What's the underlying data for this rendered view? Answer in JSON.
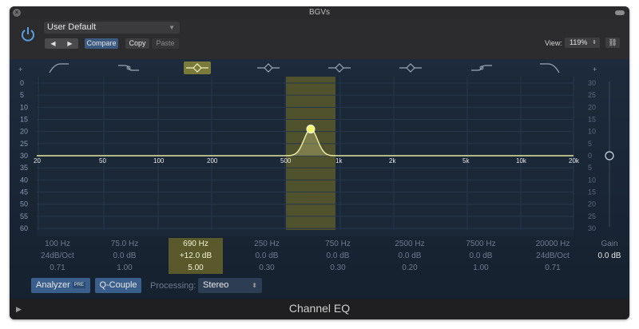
{
  "window": {
    "title": "BGVs",
    "close_glyph": "×"
  },
  "header": {
    "preset": "User Default",
    "compare_label": "Compare",
    "copy_label": "Copy",
    "paste_label": "Paste",
    "view_label": "View:",
    "zoom": "119%",
    "prev_icon": "◀",
    "next_icon": "▶"
  },
  "eq": {
    "left_scale": [
      "0",
      "5",
      "10",
      "15",
      "20",
      "25",
      "30",
      "35",
      "40",
      "45",
      "50",
      "55",
      "60"
    ],
    "right_scale": [
      "30",
      "25",
      "20",
      "15",
      "10",
      "5",
      "0",
      "5",
      "10",
      "15",
      "20",
      "25",
      "30"
    ],
    "freq_labels": [
      "20",
      "50",
      "100",
      "200",
      "500",
      "1k",
      "2k",
      "5k",
      "10k",
      "20k"
    ],
    "active_band_index": 2,
    "curve_color": "#e8e8a0",
    "highlight_color": "#59592c"
  },
  "bands": [
    {
      "freq": "100 Hz",
      "gain": "24dB/Oct",
      "q": "0.71"
    },
    {
      "freq": "75.0 Hz",
      "gain": "0.0 dB",
      "q": "1.00"
    },
    {
      "freq": "690 Hz",
      "gain": "+12.0 dB",
      "q": "5.00"
    },
    {
      "freq": "250 Hz",
      "gain": "0.0 dB",
      "q": "0.30"
    },
    {
      "freq": "750 Hz",
      "gain": "0.0 dB",
      "q": "0.30"
    },
    {
      "freq": "2500 Hz",
      "gain": "0.0 dB",
      "q": "0.20"
    },
    {
      "freq": "7500 Hz",
      "gain": "0.0 dB",
      "q": "1.00"
    },
    {
      "freq": "20000 Hz",
      "gain": "24dB/Oct",
      "q": "0.71"
    }
  ],
  "gain": {
    "label": "Gain",
    "value": "0.0 dB"
  },
  "bottom": {
    "analyzer_label": "Analyzer",
    "analyzer_badge": "PRE",
    "qcouple_label": "Q-Couple",
    "processing_label": "Processing:",
    "processing_value": "Stereo"
  },
  "footer": {
    "title": "Channel EQ"
  }
}
